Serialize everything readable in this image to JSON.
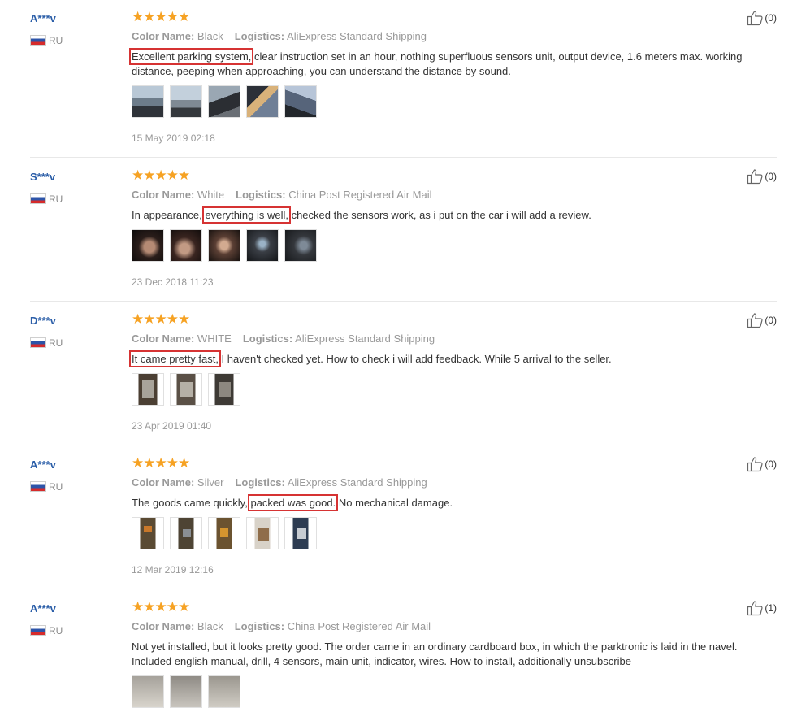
{
  "labels": {
    "color_name": "Color Name:",
    "logistics": "Logistics:"
  },
  "reviews": [
    {
      "user": "A***v",
      "country": "RU",
      "stars": "★★★★★",
      "rating": 5,
      "color": "Black",
      "logistics": "AliExpress Standard Shipping",
      "text_highlight": "Excellent parking system,",
      "text_rest": " clear instruction set in an hour, nothing superfluous sensors unit, output device, 1.6 meters max. working distance, peeping when approaching, you can understand the distance by sound.",
      "date": "15 May 2019 02:18",
      "likes": "(0)",
      "photos": 5
    },
    {
      "user": "S***v",
      "country": "RU",
      "stars": "★★★★★",
      "rating": 5,
      "color": "White",
      "logistics": "China Post Registered Air Mail",
      "text_before": "In appearance, ",
      "text_highlight": "everything is well,",
      "text_rest": " checked the sensors work, as i put on the car i will add a review.",
      "date": "23 Dec 2018 11:23",
      "likes": "(0)",
      "photos": 5
    },
    {
      "user": "D***v",
      "country": "RU",
      "stars": "★★★★★",
      "rating": 5,
      "color": "WHITE",
      "logistics": "AliExpress Standard Shipping",
      "text_highlight": "It came pretty fast,",
      "text_rest": " I haven't checked yet. How to check i will add feedback. While 5 arrival to the seller.",
      "date": "23 Apr 2019 01:40",
      "likes": "(0)",
      "photos": 3
    },
    {
      "user": "A***v",
      "country": "RU",
      "stars": "★★★★★",
      "rating": 5,
      "color": "Silver",
      "logistics": "AliExpress Standard Shipping",
      "text_before": "The goods came quickly, ",
      "text_highlight": "packed was good.",
      "text_rest": " No mechanical damage.",
      "date": "12 Mar 2019 12:16",
      "likes": "(0)",
      "photos": 5
    },
    {
      "user": "A***v",
      "country": "RU",
      "stars": "★★★★★",
      "rating": 5,
      "color": "Black",
      "logistics": "China Post Registered Air Mail",
      "text": "Not yet installed, but it looks pretty good. The order came in an ordinary cardboard box, in which the parktronic is laid in the navel. Included english manual, drill, 4 sensors, main unit, indicator, wires. How to install, additionally unsubscribe",
      "likes": "(1)",
      "photos": 3
    }
  ]
}
